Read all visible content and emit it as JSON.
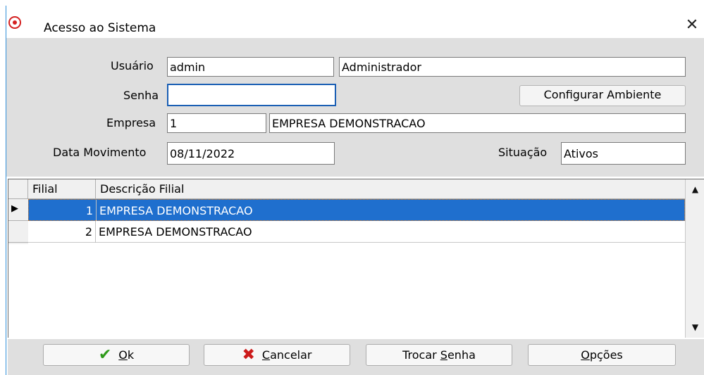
{
  "window": {
    "title": "Acesso ao Sistema",
    "app_icon": "radio-target-icon",
    "close_glyph": "✕"
  },
  "form": {
    "usuario_label": "Usuário",
    "usuario_code": "admin",
    "usuario_name": "Administrador",
    "senha_label": "Senha",
    "senha_value": "",
    "configurar_label": "Configurar Ambiente",
    "empresa_label": "Empresa",
    "empresa_code": "1",
    "empresa_name": "EMPRESA DEMONSTRACAO",
    "data_label": "Data Movimento",
    "data_value": "08/11/2022",
    "situacao_label": "Situação",
    "situacao_value": "Ativos"
  },
  "grid": {
    "columns": [
      "Filial",
      "Descrição Filial"
    ],
    "rows": [
      {
        "filial": "1",
        "descricao": "EMPRESA DEMONSTRACAO",
        "selected": true
      },
      {
        "filial": "2",
        "descricao": "EMPRESA DEMONSTRACAO",
        "selected": false
      }
    ],
    "current_row_glyph": "▶",
    "scroll_up_glyph": "▲",
    "scroll_down_glyph": "▼"
  },
  "buttons": {
    "ok": {
      "prefix": "",
      "underline": "O",
      "rest": "k",
      "icon": "check-icon",
      "glyph": "✔"
    },
    "cancel": {
      "prefix": "",
      "underline": "C",
      "rest": "ancelar",
      "icon": "x-icon",
      "glyph": "✖"
    },
    "change_password": {
      "prefix": "Trocar ",
      "underline": "S",
      "rest": "enha"
    },
    "options": {
      "prefix": "",
      "underline": "O",
      "rest": "pções"
    }
  },
  "colors": {
    "selection": "#1f6fce",
    "form_background": "#dfdfdf",
    "focus_border": "#1a5fb4",
    "ok_icon": "#2f9a1a",
    "cancel_icon": "#cc1a1a"
  }
}
